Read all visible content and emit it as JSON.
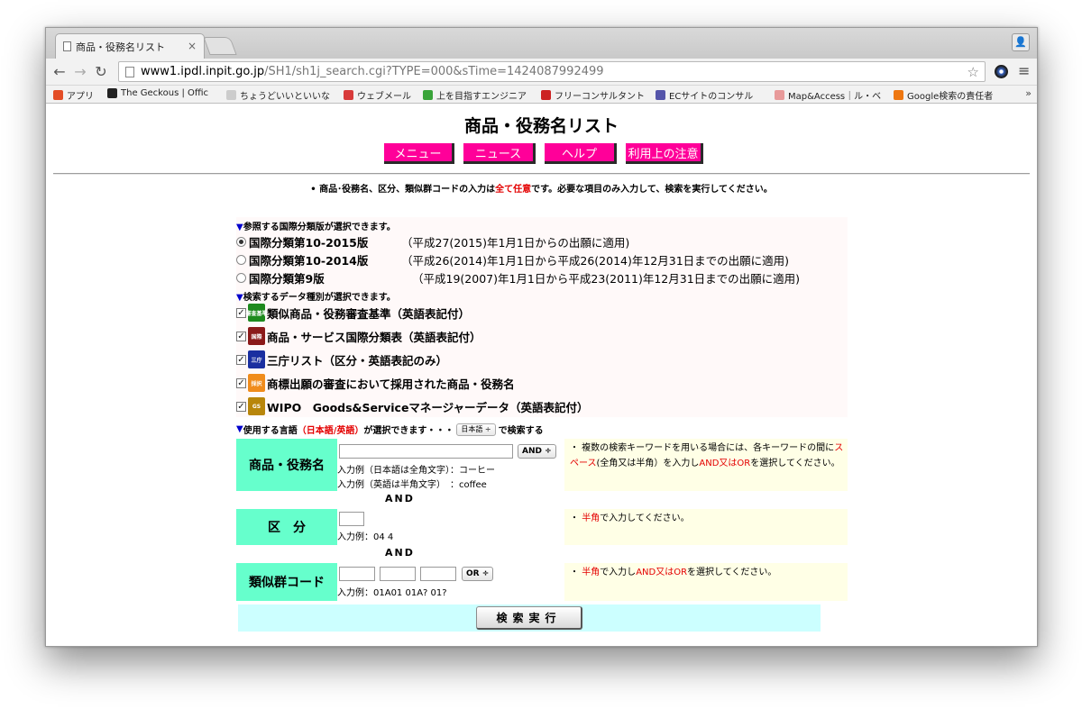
{
  "browser": {
    "tab_title": "商品・役務名リスト",
    "tab_close": "×",
    "url_host": "www1.ipdl.inpit.go.jp",
    "url_path": "/SH1/sh1j_search.cgi?TYPE=000&sTime=1424087992499",
    "bookmarks": [
      {
        "label": "アプリ",
        "color": "#e34d26"
      },
      {
        "label": "The Geckous | Offic",
        "color": "#222222"
      },
      {
        "label": "ちょうどいいといいな",
        "color": "#cccccc"
      },
      {
        "label": "ウェブメール",
        "color": "#d83b3b"
      },
      {
        "label": "上を目指すエンジニア",
        "color": "#3aa43a"
      },
      {
        "label": "フリーコンサルタント",
        "color": "#cc2222"
      },
      {
        "label": "ECサイトのコンサル",
        "color": "#5555aa"
      },
      {
        "label": "Map&Access｜ル・ベ",
        "color": "#e89a9a"
      },
      {
        "label": "Google検索の責任者",
        "color": "#ee7711"
      }
    ],
    "bookmarks_more": "»"
  },
  "page": {
    "title": "商品・役務名リスト",
    "menu": [
      {
        "label": "メニュー"
      },
      {
        "label": "ニュース"
      },
      {
        "label": "ヘルプ"
      },
      {
        "label": "利用上の注意"
      }
    ],
    "note_pre": "商品･役務名、区分、類似群コードの入力は",
    "note_red": "全て任意",
    "note_post": "です。必要な項目のみ入力して、検索を実行してください。",
    "classification_head": "参照する国際分類版が選択できます。",
    "classifications": [
      {
        "label": "国際分類第10-2015版",
        "note": "（平成27(2015)年1月1日からの出願に適用)",
        "selected": true
      },
      {
        "label": "国際分類第10-2014版",
        "note": "（平成26(2014)年1月1日から平成26(2014)年12月31日までの出願に適用)",
        "selected": false
      },
      {
        "label": "国際分類第9版",
        "note": "（平成19(2007)年1月1日から平成23(2011)年12月31日までの出願に適用)",
        "selected": false
      }
    ],
    "datatype_head": "検索するデータ種別が選択できます。",
    "datatypes": [
      {
        "label": "類似商品・役務審査基準（英語表記付）",
        "badge": "審査基準",
        "color": "#1e8a1e"
      },
      {
        "label": "商品・サービス国際分類表（英語表記付）",
        "badge": "国際",
        "color": "#8b1a1a"
      },
      {
        "label": "三庁リスト（区分・英語表記のみ）",
        "badge": "三庁",
        "color": "#1a2fa0"
      },
      {
        "label": "商標出願の審査において採用された商品・役務名",
        "badge": "採択",
        "color": "#f08c1c"
      },
      {
        "label": "WIPO　Goods&Serviceマネージャーデータ（英語表記付）",
        "badge": "GS",
        "color": "#b8860b"
      }
    ],
    "lang_head_pre": "使用する言語",
    "lang_head_red": "（日本語/英語）",
    "lang_head_mid": "が選択できます・・・",
    "lang_select": "日本語 ÷",
    "lang_head_post": "で検索する",
    "goods": {
      "label": "商品・役務名",
      "op": "AND ÷",
      "ex1": "入力例（日本語は全角文字）：コーヒー",
      "ex2": "入力例（英語は半角文字）　：coffee",
      "info_pre": "・ 複数の検索キーワードを用いる場合には、各キーワードの間に",
      "info_red1": "スペース",
      "info_mid": "(全角又は半角）を入力し",
      "info_red2": "AND又はOR",
      "info_post": "を選択してください。"
    },
    "and1": "AND",
    "kubun": {
      "label": "区　分",
      "ex": "入力例：04 4",
      "info_pre": "・ ",
      "info_red": "半角",
      "info_post": "で入力してください。"
    },
    "and2": "AND",
    "ruiji": {
      "label": "類似群コード",
      "op": "OR ÷",
      "ex": "入力例：01A01 01A? 01?",
      "info_pre": "・ ",
      "info_red1": "半角",
      "info_mid": "で入力し",
      "info_red2": "AND又はOR",
      "info_post": "を選択してください。"
    },
    "submit": "検索実行"
  }
}
